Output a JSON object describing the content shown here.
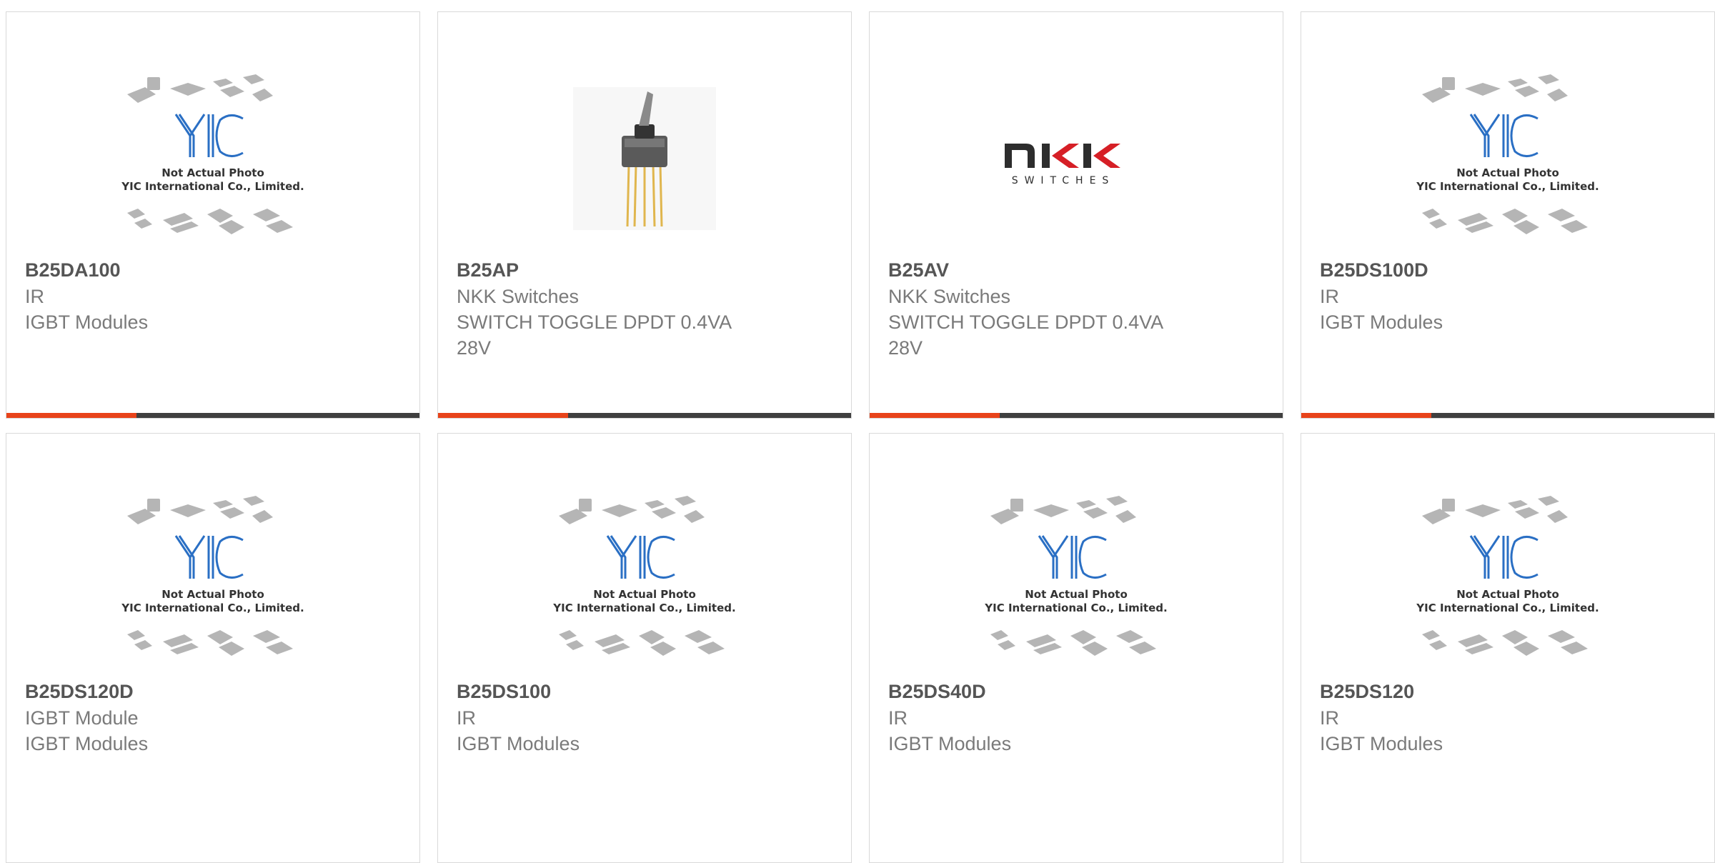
{
  "placeholder": {
    "caption_1": "Not Actual Photo",
    "caption_2": "YIC International Co., Limited.",
    "logo_text": "YIC"
  },
  "nkk_logo": {
    "brand": "NKK",
    "sub": "SWITCHES"
  },
  "colors": {
    "accent": "#e8431a",
    "bar": "#3f3f3f",
    "part_text": "#555555",
    "sub_text": "#7a7a7a"
  },
  "products": [
    {
      "part": "B25DA100",
      "manufacturer": "IR",
      "description": "IGBT Modules",
      "image": "yic-placeholder"
    },
    {
      "part": "B25AP",
      "manufacturer": "NKK Switches",
      "description": "SWITCH TOGGLE DPDT 0.4VA\n28V",
      "image": "toggle-switch-photo"
    },
    {
      "part": "B25AV",
      "manufacturer": "NKK Switches",
      "description": "SWITCH TOGGLE DPDT 0.4VA\n28V",
      "image": "nkk-logo"
    },
    {
      "part": "B25DS100D",
      "manufacturer": "IR",
      "description": "IGBT Modules",
      "image": "yic-placeholder"
    },
    {
      "part": "B25DS120D",
      "manufacturer": "IGBT Module",
      "description": "IGBT Modules",
      "image": "yic-placeholder"
    },
    {
      "part": "B25DS100",
      "manufacturer": "IR",
      "description": "IGBT Modules",
      "image": "yic-placeholder"
    },
    {
      "part": "B25DS40D",
      "manufacturer": "IR",
      "description": "IGBT Modules",
      "image": "yic-placeholder"
    },
    {
      "part": "B25DS120",
      "manufacturer": "IR",
      "description": "IGBT Modules",
      "image": "yic-placeholder"
    }
  ]
}
